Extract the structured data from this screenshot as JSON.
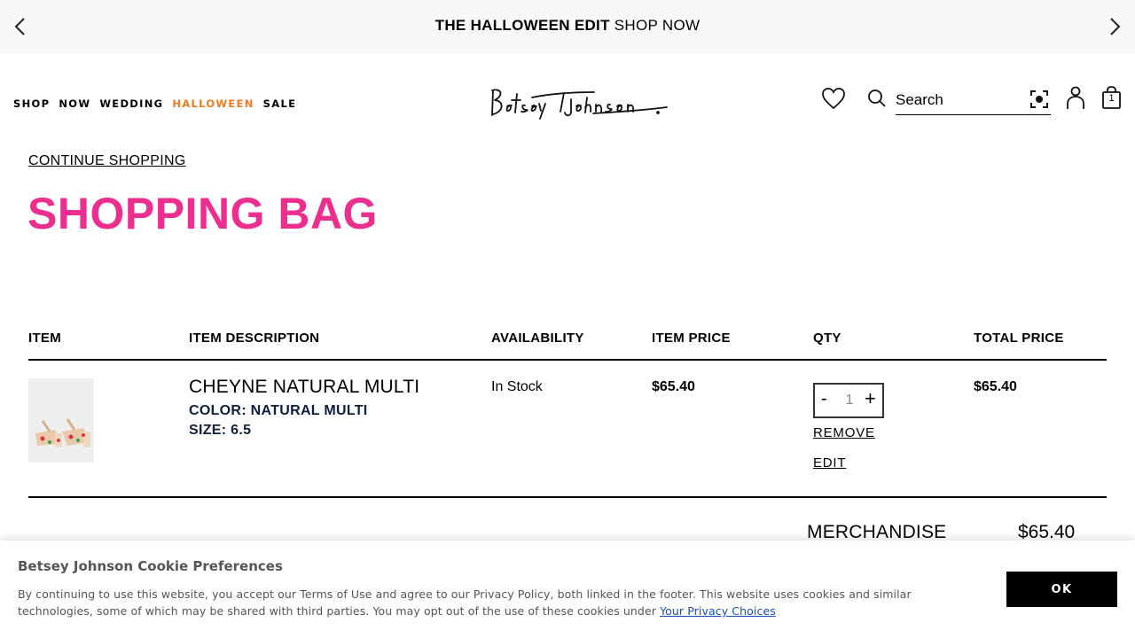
{
  "promo": {
    "bold_text": "THE HALLOWEEN EDIT",
    "link_text": "SHOP NOW"
  },
  "nav": {
    "items": [
      "SHOP",
      "NOW",
      "WEDDING",
      "HALLOWEEN",
      "SALE"
    ],
    "highlight_color": "#f07a1f"
  },
  "header": {
    "logo_text": "Betsey Johnson",
    "search_placeholder": "Search",
    "bag_count": "1"
  },
  "page": {
    "continue_label": "CONTINUE SHOPPING",
    "title": "SHOPPING BAG",
    "title_color": "#ec2f8f"
  },
  "table": {
    "headers": [
      "ITEM",
      "ITEM DESCRIPTION",
      "AVAILABILITY",
      "ITEM PRICE",
      "QTY",
      "TOTAL PRICE"
    ],
    "row": {
      "name": "CHEYNE NATURAL MULTI",
      "color": "COLOR: NATURAL MULTI",
      "size": "SIZE: 6.5",
      "availability": "In Stock",
      "item_price": "$65.40",
      "qty": "1",
      "qty_minus": "-",
      "qty_plus": "+",
      "remove_label": "REMOVE",
      "edit_label": "EDIT",
      "total_price": "$65.40"
    }
  },
  "summary": {
    "merch_label": "MERCHANDISE",
    "merch_value": "$65.40"
  },
  "cookie": {
    "title": "Betsey Johnson Cookie Preferences",
    "body": "By continuing to use this website, you accept our Terms of Use and agree to our Privacy Policy, both linked in the footer. This website uses cookies and similar technologies, some of which may be shared with third parties. You may opt out of the use of these cookies under ",
    "link": "Your Privacy Choices",
    "ok_label": "OK"
  },
  "icons": {
    "prev": "chevron-left-icon",
    "next": "chevron-right-icon",
    "wishlist": "heart-icon",
    "search": "search-icon",
    "visual_search": "camera-scan-icon",
    "account": "user-icon",
    "bag": "shopping-bag-icon"
  }
}
